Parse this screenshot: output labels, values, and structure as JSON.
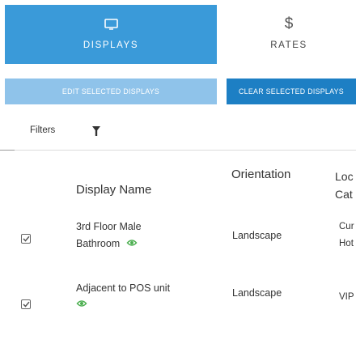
{
  "tiles": {
    "displays": {
      "label": "DISPLAYS",
      "icon": "display-icon",
      "active": true
    },
    "rates": {
      "symbol": "$",
      "label": "RATES",
      "icon": "dollar-icon"
    }
  },
  "actions": {
    "edit_label": "EDIT SELECTED DISPLAYS",
    "clear_label": "CLEAR SELECTED DISPLAYS"
  },
  "filters": {
    "label": "Filters",
    "icon": "funnel-icon"
  },
  "table": {
    "headers": {
      "display_name": "Display Name",
      "orientation": "Orientation",
      "location_line1": "Loc",
      "location_line2": "Cat"
    },
    "rows": [
      {
        "checked": true,
        "name_line1": "3rd Floor Male",
        "name_line2": "Bathroom",
        "orientation": "Landscape",
        "location_line1": "Cur",
        "location_line2": "Hot"
      },
      {
        "checked": true,
        "name_line1": "Adjacent to POS unit",
        "orientation": "Landscape",
        "location_line1": "VIP"
      }
    ]
  },
  "colors": {
    "tile_active": "#3a9ad9",
    "edit_button": "#8fc3ea",
    "clear_button": "#1d7fc4",
    "eye_icon": "#4caf50"
  }
}
